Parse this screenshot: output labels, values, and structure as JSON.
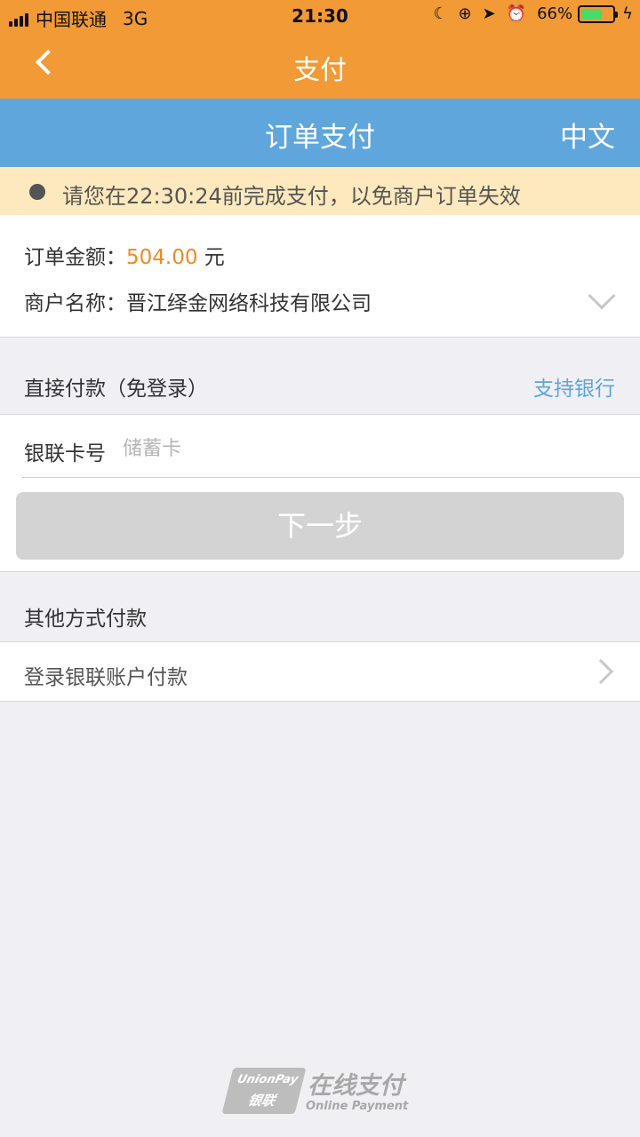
{
  "status_bar": {
    "carrier": "中国联通",
    "network": "3G",
    "time": "21:30",
    "battery": "66%",
    "battery_level": 0.66
  },
  "nav": {
    "title": "支付"
  },
  "header": {
    "title": "订单支付",
    "language": "中文"
  },
  "notice": {
    "text": "请您在22:30:24前完成支付，以免商户订单失效"
  },
  "order": {
    "amount_label": "订单金额：",
    "amount_value": "504.00",
    "amount_unit": "元",
    "merchant_label": "商户名称：",
    "merchant_value": "晋江绎金网络科技有限公司"
  },
  "direct_pay": {
    "title": "直接付款（免登录）",
    "banks_link": "支持银行",
    "card_label": "银联卡号",
    "card_placeholder": "储蓄卡",
    "next_button": "下一步"
  },
  "other_pay": {
    "title": "其他方式付款",
    "login_option": "登录银联账户付款"
  },
  "footer": {
    "logo_en": "UnionPay",
    "logo_cn": "银联",
    "title_cn": "在线支付",
    "title_en": "Online Payment"
  },
  "colors": {
    "nav_bg": "#f19a36",
    "header_bg": "#5fa6dc",
    "notice_bg": "#fde9bd",
    "amount": "#f08a24",
    "link": "#5fa6dc",
    "button_disabled": "#d3d3d3"
  }
}
